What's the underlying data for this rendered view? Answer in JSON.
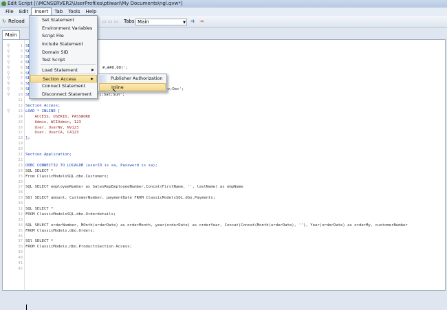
{
  "window": {
    "title": "Edit Script [\\\\MCNSERVER2\\UserProfiles\\ptiwari\\My Documents\\ngl.qvw*]"
  },
  "menubar": [
    "File",
    "Edit",
    "Insert",
    "Tab",
    "Tools",
    "Help"
  ],
  "toolbar": {
    "reload": "Reload",
    "tabs_label": "Tabs",
    "tabs_value": "Main"
  },
  "tab": "Main",
  "insert_menu": [
    "Set Statement",
    "Environment Variables",
    "Script File",
    "Include Statement",
    "Domain SID",
    "Test Script",
    "Load Statement",
    "Section Access",
    "Connect Statement",
    "Disconnect Statement"
  ],
  "section_access_submenu": [
    "Publisher Authorization",
    "Inline"
  ],
  "code_lines": [
    {
      "n": "1",
      "t": "SE"
    },
    {
      "n": "2",
      "t": "SE"
    },
    {
      "n": "3",
      "t": "SE"
    },
    {
      "n": "4",
      "t": "SE"
    },
    {
      "n": "5",
      "t": "SE",
      "tail": "#,##0.00)';"
    },
    {
      "n": "6",
      "t": "SE"
    },
    {
      "n": "7",
      "t": "SE"
    },
    {
      "n": "8",
      "t": "SE"
    },
    {
      "n": "9",
      "t": "SE",
      "tail": "Nov;Dec';"
    },
    {
      "n": "10",
      "t": "SE",
      "tail": ";Fri;Sat;Sun';"
    },
    {
      "n": "11",
      "t": ""
    },
    {
      "n": "12",
      "t": "Section Access;",
      "k": "kw"
    },
    {
      "n": "13",
      "t": "LOAD * INLINE [",
      "k": "kw"
    },
    {
      "n": "14",
      "t": "    ACCESS, USERID, PASSWORD",
      "k": "str"
    },
    {
      "n": "15",
      "t": "    Admin, WCIAdmin, 123",
      "k": "str"
    },
    {
      "n": "16",
      "t": "    User, UserNV, NV123",
      "k": "str"
    },
    {
      "n": "17",
      "t": "    User, UserCA, CA123",
      "k": "str"
    },
    {
      "n": "18",
      "t": "];",
      "k": "kw"
    },
    {
      "n": "19",
      "t": ""
    },
    {
      "n": "20",
      "t": ""
    },
    {
      "n": "21",
      "t": "Section Application;",
      "k": "kw"
    },
    {
      "n": "22",
      "t": ""
    },
    {
      "n": "23",
      "t": "ODBC CONNECT32 TO LOCALDB (userID is sa, Password is sa);",
      "k": "kw"
    },
    {
      "n": "24",
      "t": "SQL SELECT *"
    },
    {
      "n": "25",
      "t": "From ClassicModelsSQL.dbo.Customers;"
    },
    {
      "n": "26",
      "t": ""
    },
    {
      "n": "27",
      "t": "SQL SELECT employeeNumber as SalesRepEmployeeNumber,Concat(FirstName, '', lastName) as empName"
    },
    {
      "n": "28",
      "t": ""
    },
    {
      "n": "29",
      "t": "SQl SELECT amount, CustomerNumber, paymentDate FROM ClassicModelsSQL.dbo.Payments;"
    },
    {
      "n": "30",
      "t": ""
    },
    {
      "n": "31",
      "t": "SQL SELECT *"
    },
    {
      "n": "32",
      "t": "FROM ClassicModelsSQL.dbo.Orderdetails;"
    },
    {
      "n": "33",
      "t": ""
    },
    {
      "n": "34",
      "t": "SQL SELECT orderNumber, MOnth(orderDate) as orderMonth, year(orderDate) as orderYear, Concat(Concat(Month(orderDate), ''), Year(orderDate) as orderMy, customerNumber"
    },
    {
      "n": "35",
      "t": "FROM ClassicModels.dbo.Orders;"
    },
    {
      "n": "36",
      "t": ""
    },
    {
      "n": "37",
      "t": "SQl SELECT *"
    },
    {
      "n": "38",
      "t": "FROM ClassicModels.dbo.ProductsSection Access;"
    },
    {
      "n": "39",
      "t": ""
    },
    {
      "n": "40",
      "t": ""
    },
    {
      "n": "41",
      "t": ""
    },
    {
      "n": "42",
      "t": ""
    }
  ]
}
